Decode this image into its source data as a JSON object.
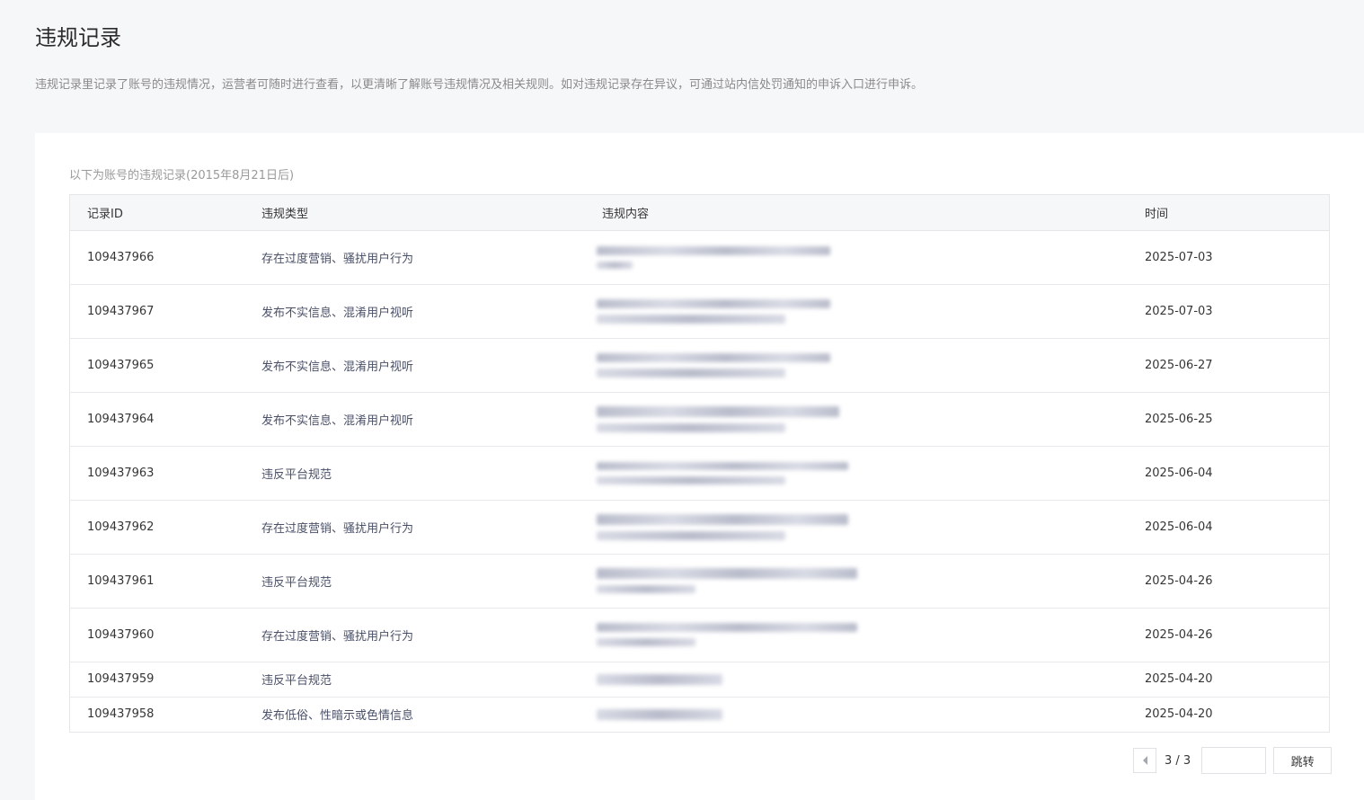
{
  "page": {
    "title": "违规记录",
    "description": "违规记录里记录了账号的违规情况，运营者可随时进行查看，以更清晰了解账号违规情况及相关规则。如对违规记录存在异议，可通过站内信处罚通知的申诉入口进行申诉。"
  },
  "records": {
    "caption": "以下为账号的违规记录(2015年8月21日后)",
    "headers": {
      "id": "记录ID",
      "type": "违规类型",
      "content": "违规内容",
      "time": "时间"
    },
    "rows": [
      {
        "id": "109437966",
        "type": "存在过度营销、骚扰用户行为",
        "time": "2025-07-03"
      },
      {
        "id": "109437967",
        "type": "发布不实信息、混淆用户视听",
        "time": "2025-07-03"
      },
      {
        "id": "109437965",
        "type": "发布不实信息、混淆用户视听",
        "time": "2025-06-27"
      },
      {
        "id": "109437964",
        "type": "发布不实信息、混淆用户视听",
        "time": "2025-06-25"
      },
      {
        "id": "109437963",
        "type": "违反平台规范",
        "time": "2025-06-04"
      },
      {
        "id": "109437962",
        "type": "存在过度营销、骚扰用户行为",
        "time": "2025-06-04"
      },
      {
        "id": "109437961",
        "type": "违反平台规范",
        "time": "2025-04-26"
      },
      {
        "id": "109437960",
        "type": "存在过度营销、骚扰用户行为",
        "time": "2025-04-26"
      },
      {
        "id": "109437959",
        "type": "违反平台规范",
        "time": "2025-04-20"
      },
      {
        "id": "109437958",
        "type": "发布低俗、性暗示或色情信息",
        "time": "2025-04-20"
      }
    ]
  },
  "pagination": {
    "current": "3 / 3",
    "jump_value": "",
    "jump_label": "跳转"
  },
  "colors": {
    "blur_dark": "#b9bccb",
    "blur_light": "#d8dae4"
  }
}
